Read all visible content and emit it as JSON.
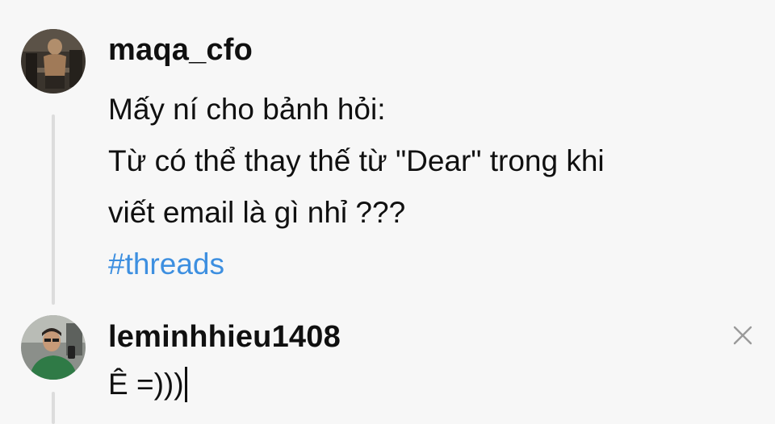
{
  "post": {
    "username": "maqa_cfo",
    "lines": [
      "Mấy ní cho bảnh hỏi:",
      "Từ có thể thay thế từ \"Dear\" trong khi",
      "viết email là gì nhỉ ???"
    ],
    "hashtag": "#threads"
  },
  "reply": {
    "username": "leminhhieu1408",
    "input_value": "Ê =)))"
  },
  "colors": {
    "hashtag": "#3d8fe0",
    "text": "#101010",
    "background": "#f7f7f7"
  },
  "icons": {
    "close": "close-icon"
  }
}
